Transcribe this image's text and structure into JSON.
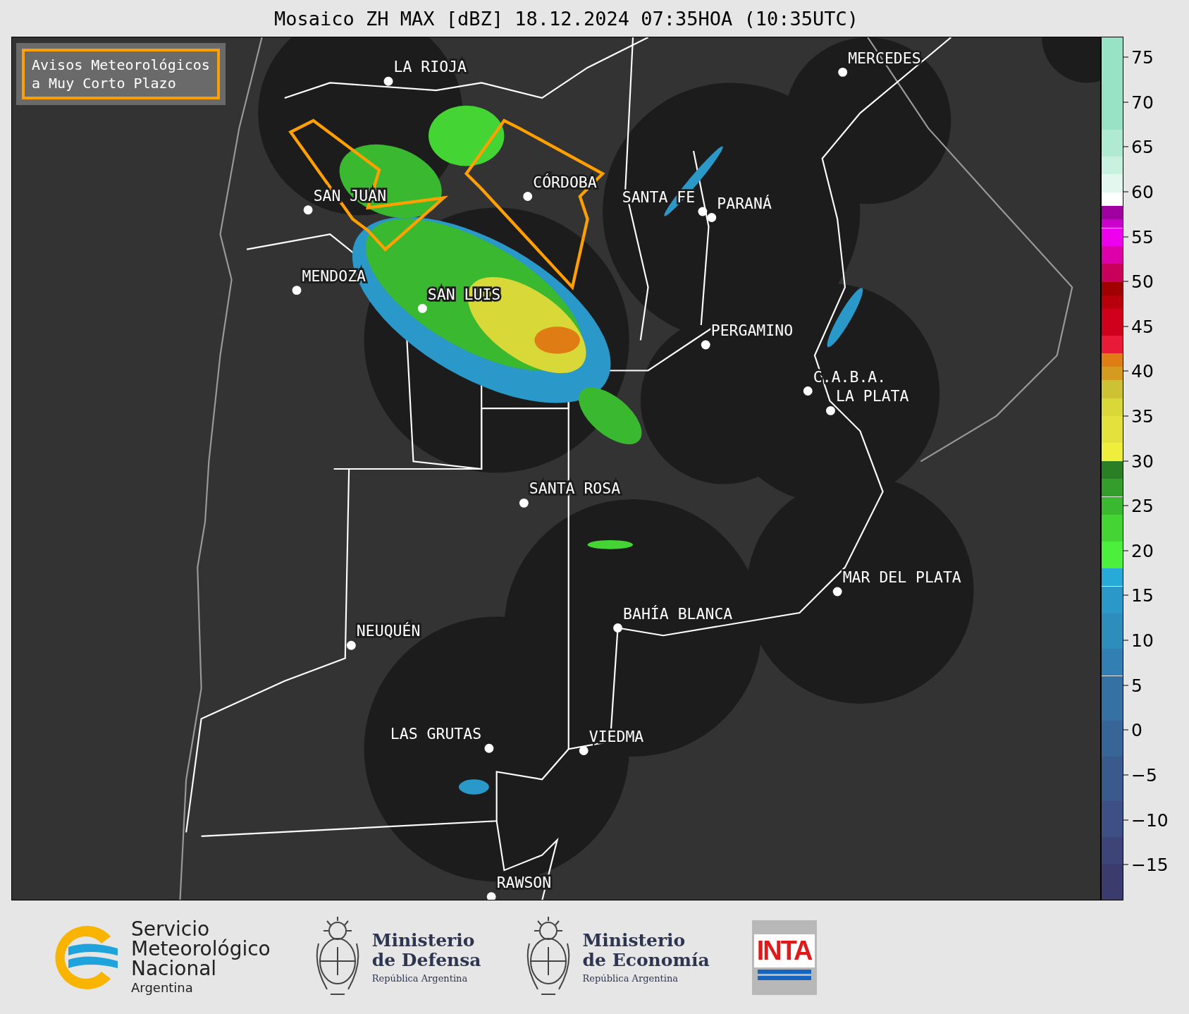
{
  "title": "Mosaico ZH MAX [dBZ] 18.12.2024 07:35HOA (10:35UTC)",
  "legend_box": {
    "lines": [
      "Avisos Meteorológicos",
      "a Muy Corto Plazo"
    ]
  },
  "cities": [
    {
      "name": "LA RIOJA"
    },
    {
      "name": "MERCEDES"
    },
    {
      "name": "SAN JUAN"
    },
    {
      "name": "CÓRDOBA"
    },
    {
      "name": "SANTA FE"
    },
    {
      "name": "PARANÁ"
    },
    {
      "name": "MENDOZA"
    },
    {
      "name": "SAN LUIS"
    },
    {
      "name": "PERGAMINO"
    },
    {
      "name": "C.A.B.A."
    },
    {
      "name": "LA PLATA"
    },
    {
      "name": "SANTA ROSA"
    },
    {
      "name": "MAR DEL PLATA"
    },
    {
      "name": "BAHÍA BLANCA"
    },
    {
      "name": "NEUQUÉN"
    },
    {
      "name": "LAS GRUTAS"
    },
    {
      "name": "VIEDMA"
    },
    {
      "name": "RAWSON"
    }
  ],
  "colorbar": {
    "ticks": [
      "75",
      "70",
      "65",
      "60",
      "55",
      "50",
      "45",
      "40",
      "35",
      "30",
      "25",
      "20",
      "15",
      "10",
      "5",
      "0",
      "−5",
      "−10",
      "−15"
    ]
  },
  "footer": {
    "logos": [
      {
        "kind": "smn",
        "lines": [
          "Servicio",
          "Meteorológico",
          "Nacional"
        ],
        "subtitle": "Argentina"
      },
      {
        "kind": "ministry",
        "lines": [
          "Ministerio",
          "de Defensa"
        ],
        "subtitle": "República Argentina"
      },
      {
        "kind": "ministry",
        "lines": [
          "Ministerio",
          "de Economía"
        ],
        "subtitle": "República Argentina"
      },
      {
        "kind": "inta",
        "lines": [
          "INTA"
        ]
      }
    ]
  }
}
